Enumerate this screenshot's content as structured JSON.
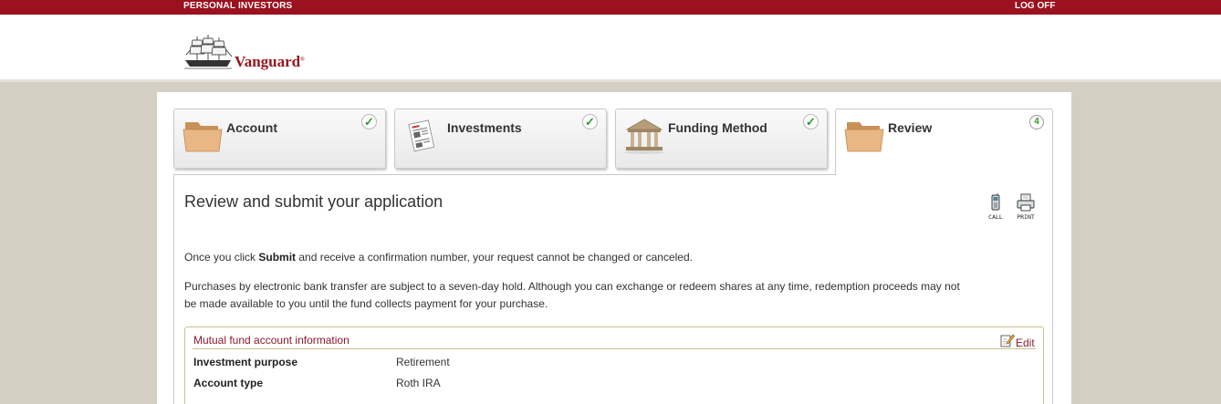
{
  "top_nav": {
    "site": "PERSONAL INVESTORS",
    "log_off": "LOG OFF"
  },
  "brand": {
    "name": "Vanguard",
    "mark": "®"
  },
  "steps": [
    {
      "label": "Account",
      "icon": "folder-icon",
      "status": "complete"
    },
    {
      "label": "Investments",
      "icon": "document-icon",
      "status": "complete"
    },
    {
      "label": "Funding Method",
      "icon": "bank-icon",
      "status": "complete"
    },
    {
      "label": "Review",
      "icon": "folder-icon",
      "status": "current",
      "number": "4"
    }
  ],
  "page": {
    "title": "Review and submit your application",
    "tools": {
      "call": "CALL",
      "print": "PRINT"
    },
    "notice_pre": "Once you click ",
    "notice_bold": "Submit",
    "notice_post": " and receive a confirmation number, your request cannot be changed or canceled.",
    "hold_line1": "Purchases by electronic bank transfer are subject to a seven-day hold. Although you can exchange or redeem shares at any time, redemption proceeds may not",
    "hold_line2": "be made available to you until the fund collects payment for your purchase."
  },
  "account_info": {
    "heading": "Mutual fund account information",
    "edit": "Edit",
    "rows": [
      {
        "label": "Investment purpose",
        "value": "Retirement"
      },
      {
        "label": "Account type",
        "value": "Roth IRA"
      }
    ]
  },
  "colors": {
    "brand_red": "#9b111e",
    "checkmark_green": "#2e9a2e",
    "box_border": "#cbbf8f",
    "background": "#d3cfc3"
  }
}
